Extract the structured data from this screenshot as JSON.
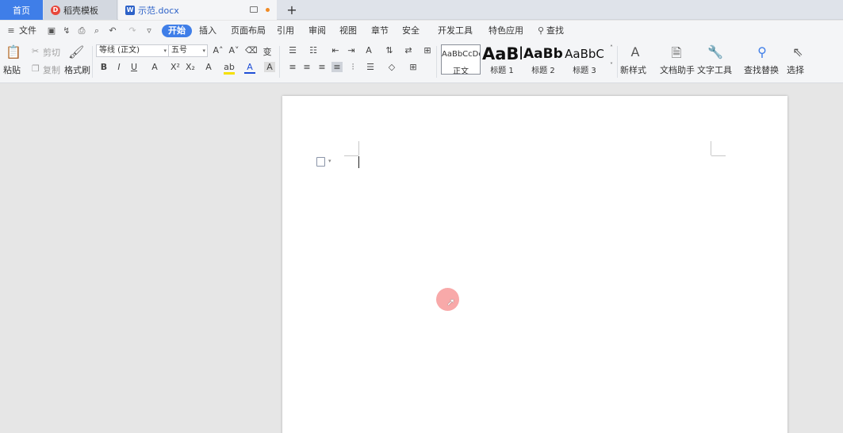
{
  "tabs": {
    "home": "首页",
    "template": "稻壳模板",
    "document": "示范.docx",
    "add": "+"
  },
  "menu": {
    "file": "文件",
    "items": [
      "开始",
      "插入",
      "页面布局",
      "引用",
      "审阅",
      "视图",
      "章节",
      "安全",
      "开发工具",
      "特色应用"
    ],
    "search": "查找"
  },
  "ribbon": {
    "paste": "粘贴",
    "cut": "剪切",
    "copy": "复制",
    "format_painter": "格式刷",
    "font_name": "等线 (正文)",
    "font_size": "五号",
    "styles": [
      {
        "sample": "AaBbCcDd",
        "label": "正文"
      },
      {
        "sample": "AaBl",
        "label": "标题 1"
      },
      {
        "sample": "AaBb(",
        "label": "标题 2"
      },
      {
        "sample": "AaBbC",
        "label": "标题 3"
      }
    ],
    "new_style": "新样式",
    "doc_assistant": "文档助手",
    "text_tools": "文字工具",
    "find_replace": "查找替换",
    "select": "选择"
  },
  "colors": {
    "accent": "#3f7ee8",
    "tab_bg": "#dfe3ea",
    "ribbon_bg": "#f4f5f7",
    "workspace": "#e6e6e6"
  }
}
